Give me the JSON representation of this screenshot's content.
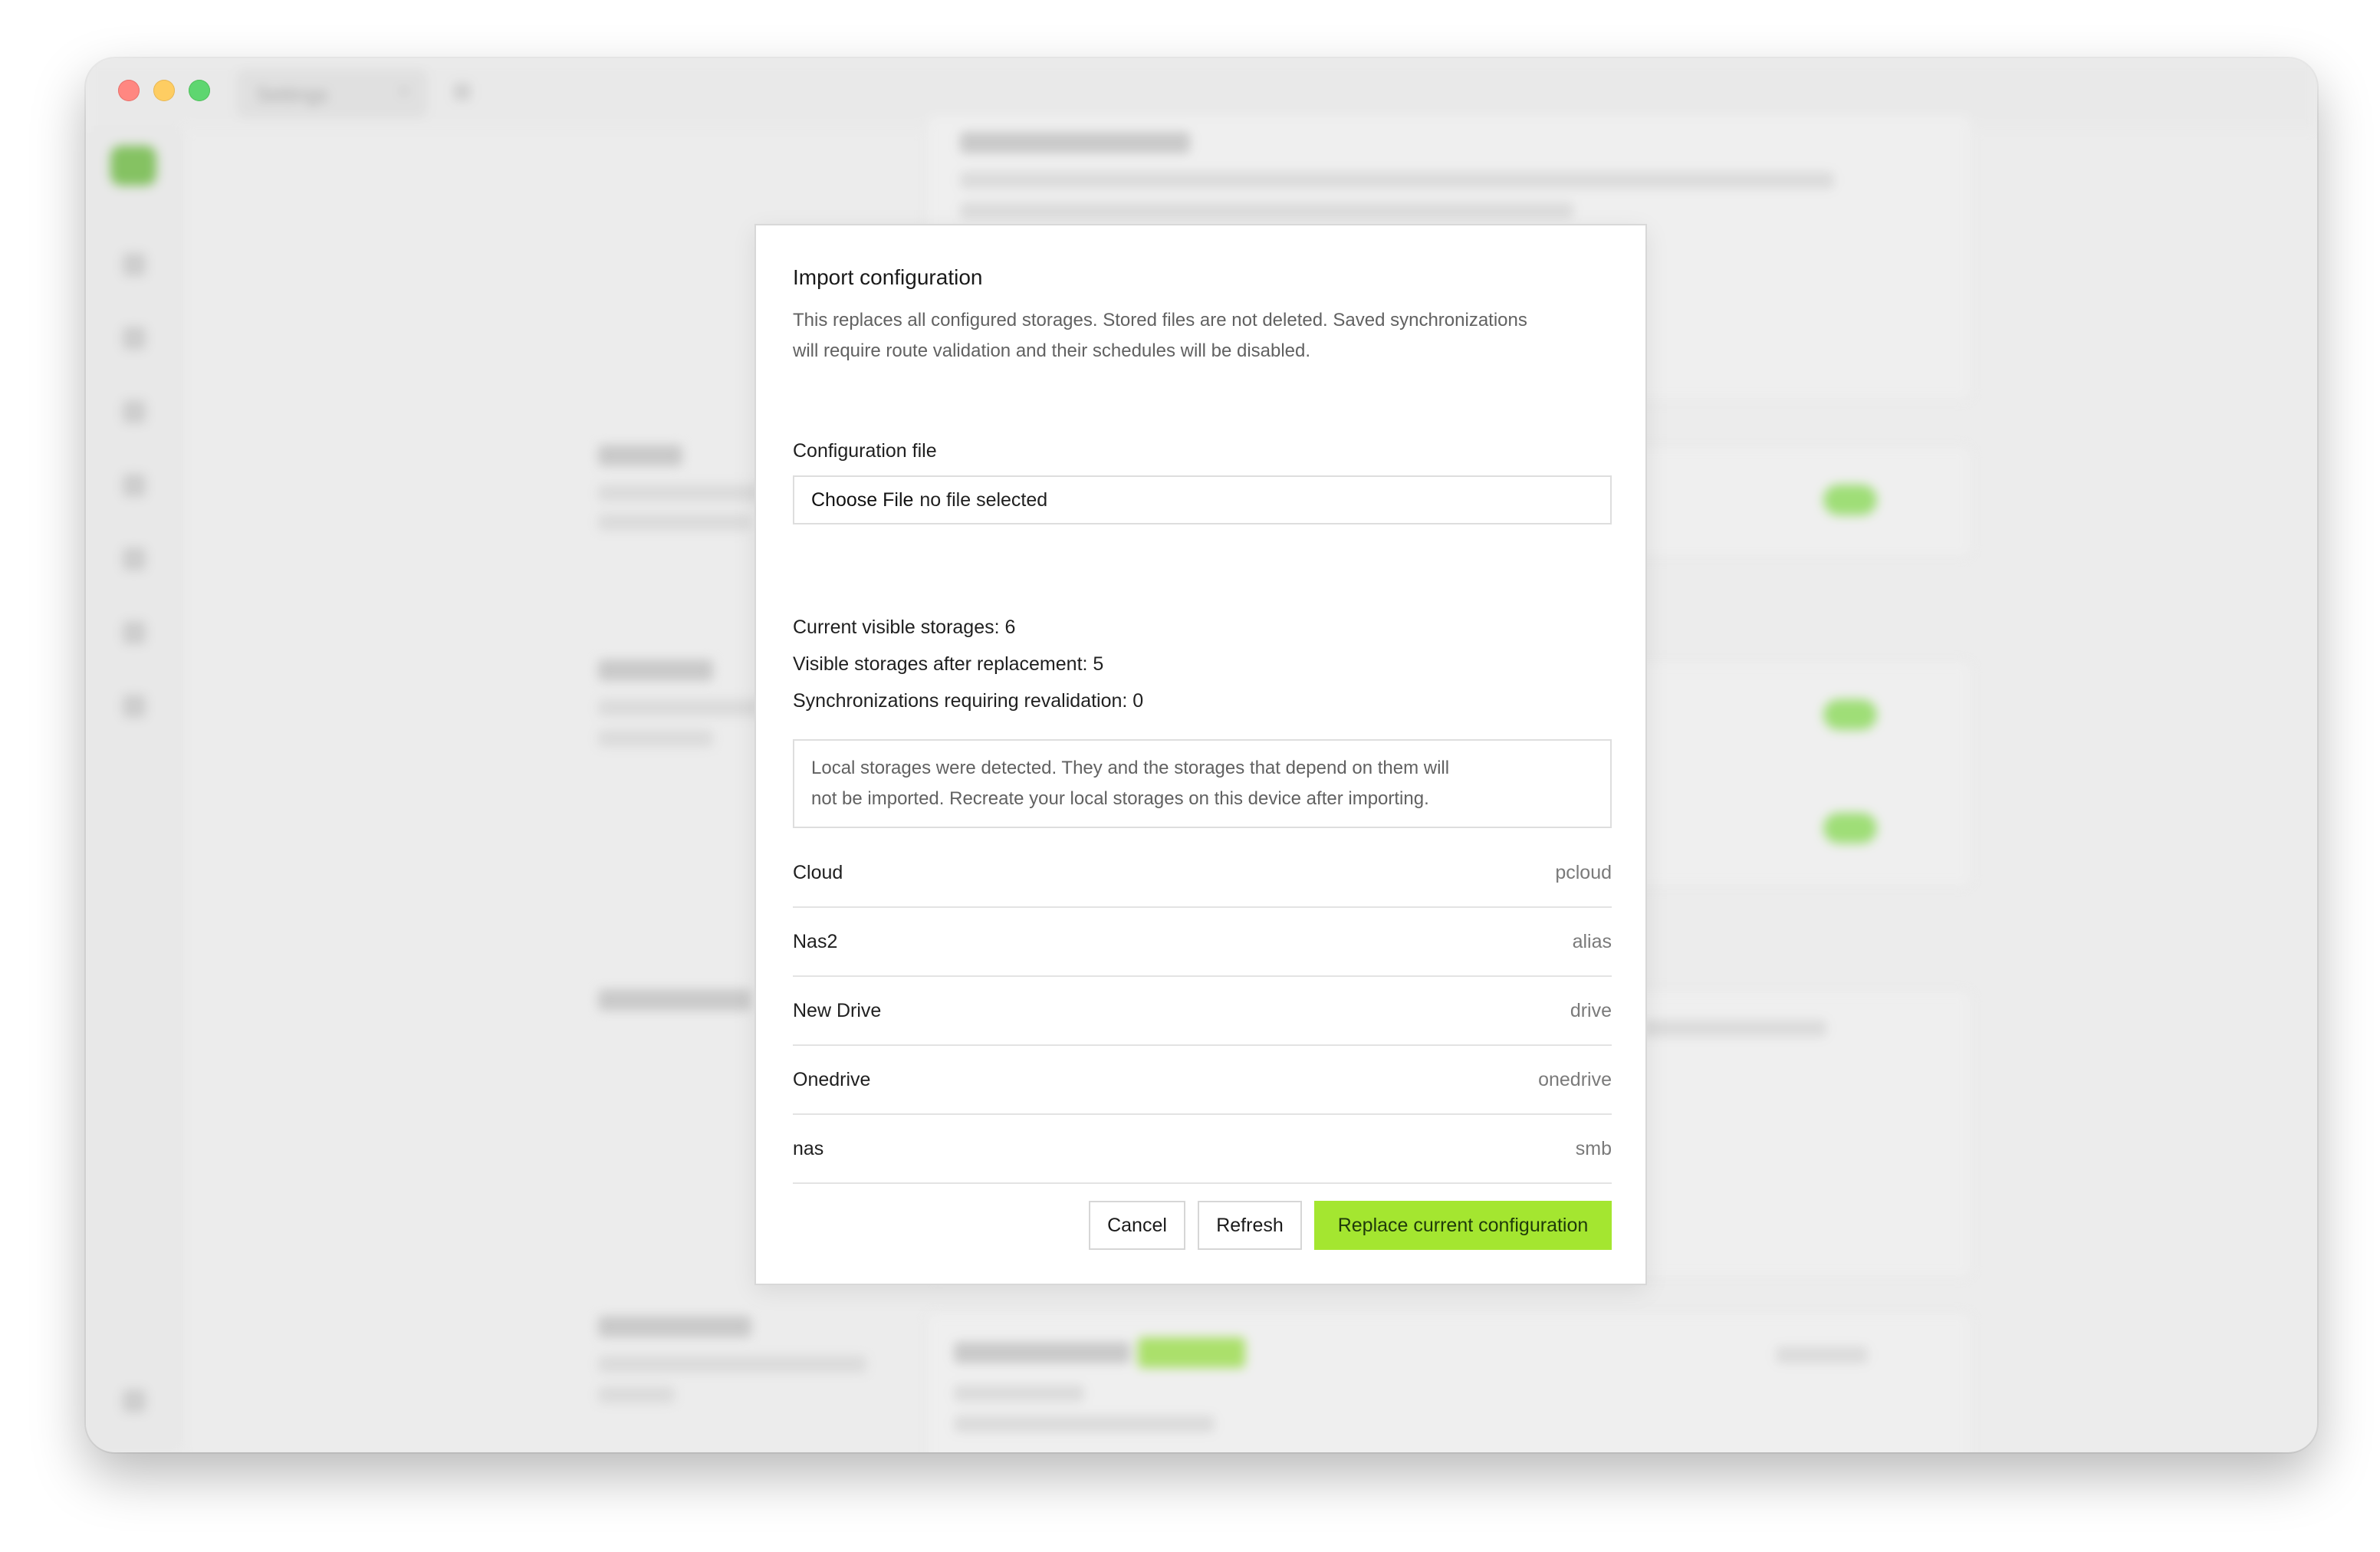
{
  "window": {
    "tab_title": "Settings",
    "tab_close_icon": "×",
    "tab_add_icon": "⊞"
  },
  "modal": {
    "title": "Import configuration",
    "description_line1": "This replaces all configured storages. Stored files are not deleted. Saved synchronizations",
    "description_line2": "will require route validation and their schedules will be disabled.",
    "file_label": "Configuration file",
    "file_button": "Choose File",
    "file_status": "no file selected",
    "stats": [
      "Current visible storages: 6",
      "Visible storages after replacement: 5",
      "Synchronizations requiring revalidation: 0"
    ],
    "notice_line1": "Local storages were detected. They and the storages that depend on them will",
    "notice_line2": "not be imported. Recreate your local storages on this device after importing.",
    "storages": [
      {
        "name": "Cloud",
        "type": "pcloud"
      },
      {
        "name": "Nas2",
        "type": "alias"
      },
      {
        "name": "New Drive",
        "type": "drive"
      },
      {
        "name": "Onedrive",
        "type": "onedrive"
      },
      {
        "name": "nas",
        "type": "smb"
      }
    ],
    "buttons": {
      "cancel": "Cancel",
      "refresh": "Refresh",
      "replace": "Replace current configuration"
    }
  },
  "colors": {
    "accent": "#a4e630",
    "window_bg": "#e6e6e6"
  }
}
